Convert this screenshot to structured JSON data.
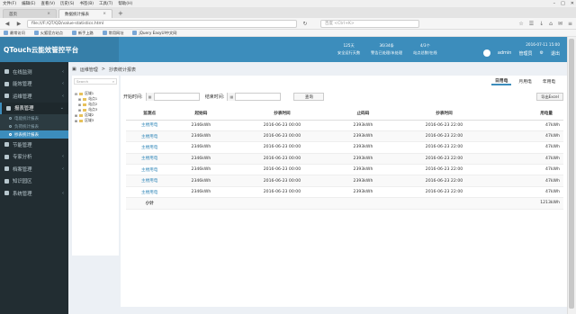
{
  "browser": {
    "menu": [
      "文件(F)",
      "编辑(E)",
      "查看(V)",
      "历史(S)",
      "书签(B)",
      "工具(T)",
      "帮助(H)"
    ],
    "tabs": [
      {
        "label": "首页"
      },
      {
        "label": "数据统计报表"
      }
    ],
    "new_tab": "+",
    "url": "file:///F:/QT/QD/value-statistics.html",
    "search_placeholder": "百度 <Ctrl+K>",
    "bookmarks": [
      "最常访问",
      "火狐官方站点",
      "新手上路",
      "常用网址",
      "jQuery EasyUI中文网"
    ]
  },
  "app": {
    "title": "QTouch云能效管控平台",
    "stats": [
      {
        "value": "125天",
        "label": "安全运行天数"
      },
      {
        "value": "36/34条",
        "label": "警告已处理/未处理"
      },
      {
        "value": "4/3个",
        "label": "站点总数/在线"
      }
    ],
    "datetime": "2016-07-11 15:00",
    "user": "admin",
    "user_role": "管理员",
    "exit_label": "退出"
  },
  "sidebar": {
    "items": [
      {
        "label": "在线监测",
        "open": false
      },
      {
        "label": "能效管理",
        "open": false
      },
      {
        "label": "运维管理",
        "open": false
      },
      {
        "label": "报表管理",
        "open": true,
        "children": [
          {
            "label": "电能统计报表",
            "active": false
          },
          {
            "label": "负荷统计报表",
            "active": false
          },
          {
            "label": "抄表统计报表",
            "active": true
          }
        ]
      },
      {
        "label": "节能管理",
        "open": false
      },
      {
        "label": "专家分析",
        "open": false
      },
      {
        "label": "档案管理",
        "open": false
      },
      {
        "label": "知识园区",
        "open": false
      },
      {
        "label": "系统管理",
        "open": false
      }
    ]
  },
  "breadcrumb": {
    "home": "运维管理",
    "sep": ">",
    "current": "抄表统计报表"
  },
  "tree": {
    "search_placeholder": "Search",
    "nodes": [
      {
        "label": "区域1",
        "level": 0
      },
      {
        "label": "站点1",
        "level": 1
      },
      {
        "label": "站点2",
        "level": 1
      },
      {
        "label": "站点3",
        "level": 1
      },
      {
        "label": "区域2",
        "level": 0
      },
      {
        "label": "区域3",
        "level": 0
      }
    ]
  },
  "period_tabs": [
    {
      "label": "日用电",
      "active": true
    },
    {
      "label": "月用电",
      "active": false
    },
    {
      "label": "年用电",
      "active": false
    }
  ],
  "filters": {
    "start_label": "开始时间:",
    "end_label": "结束时间:",
    "start_value": "",
    "end_value": "",
    "query_label": "查询",
    "export_label": "导出Excel"
  },
  "table": {
    "headers": [
      "监测点",
      "起始码",
      "抄表时间",
      "止码码",
      "抄表时间",
      "用电量"
    ],
    "rows": [
      [
        "主楼用电",
        "2346kWh",
        "2016-06-23 00:00",
        "2393kWh",
        "2016-06-23 22:00",
        "47kWh"
      ],
      [
        "主楼用电",
        "2346kWh",
        "2016-06-23 00:00",
        "2393kWh",
        "2016-06-23 22:00",
        "47kWh"
      ],
      [
        "主楼用电",
        "2346kWh",
        "2016-06-23 00:00",
        "2393kWh",
        "2016-06-23 22:00",
        "47kWh"
      ],
      [
        "主楼用电",
        "2346kWh",
        "2016-06-23 00:00",
        "2393kWh",
        "2016-06-23 22:00",
        "47kWh"
      ],
      [
        "主楼用电",
        "2346kWh",
        "2016-06-23 00:00",
        "2393kWh",
        "2016-06-23 22:00",
        "47kWh"
      ],
      [
        "主楼用电",
        "2346kWh",
        "2016-06-23 00:00",
        "2393kWh",
        "2016-06-23 22:00",
        "47kWh"
      ],
      [
        "主楼用电",
        "2346kWh",
        "2016-06-23 00:00",
        "2393kWh",
        "2016-06-23 22:00",
        "47kWh"
      ]
    ],
    "total_label": "小计",
    "total_value": "1213kWh"
  },
  "colors": {
    "brand": "#3c8dbc",
    "sidebar": "#222d32",
    "link": "#3c8dbc"
  }
}
